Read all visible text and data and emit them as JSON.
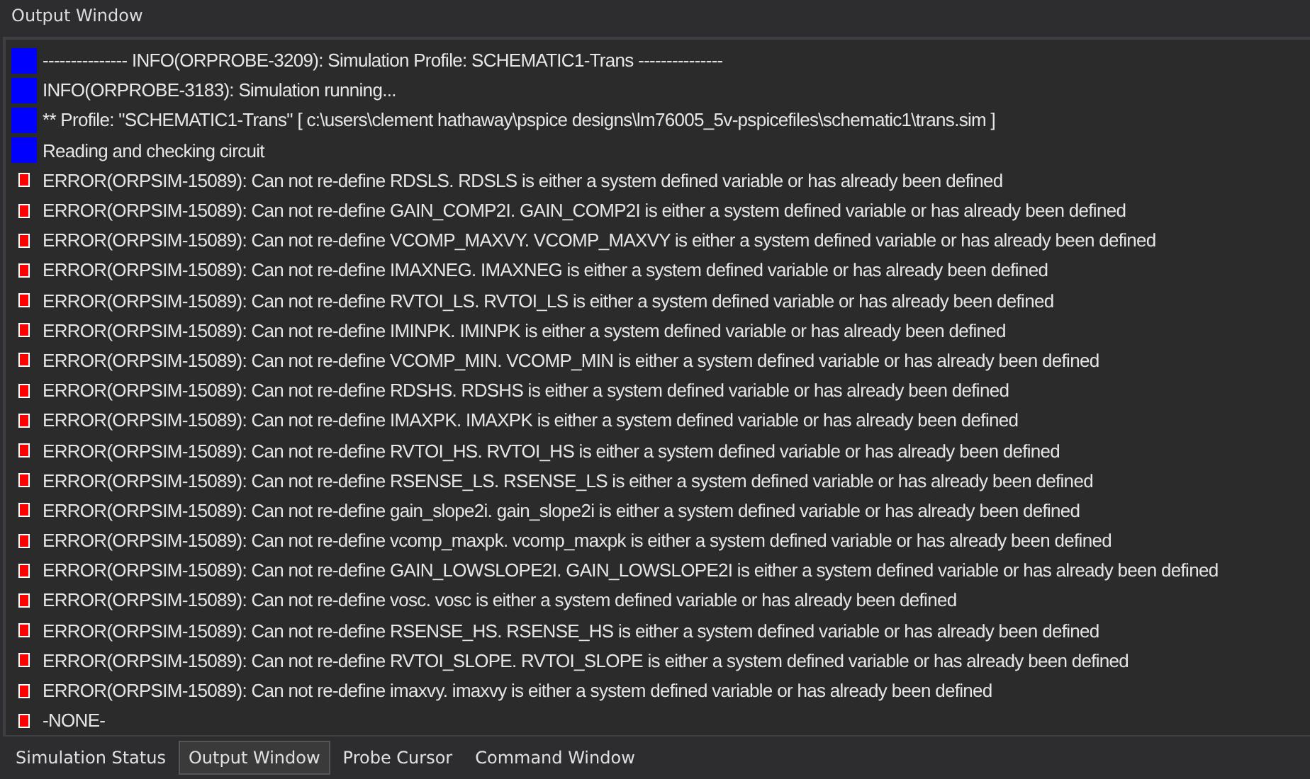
{
  "panel": {
    "title": "Output Window"
  },
  "lines": [
    {
      "kind": "info",
      "text": "--------------- INFO(ORPROBE-3209): Simulation Profile:  SCHEMATIC1-Trans ---------------"
    },
    {
      "kind": "info",
      "text": "INFO(ORPROBE-3183): Simulation running..."
    },
    {
      "kind": "info",
      "text": "** Profile: \"SCHEMATIC1-Trans\"  [ c:\\users\\clement hathaway\\pspice designs\\lm76005_5v-pspicefiles\\schematic1\\trans.sim ]"
    },
    {
      "kind": "info",
      "text": "Reading and checking circuit"
    },
    {
      "kind": "error",
      "text": "ERROR(ORPSIM-15089): Can not re-define RDSLS. RDSLS is either a system defined variable or has already been defined"
    },
    {
      "kind": "error",
      "text": "ERROR(ORPSIM-15089): Can not re-define GAIN_COMP2I. GAIN_COMP2I is either a system defined variable or has already been defined"
    },
    {
      "kind": "error",
      "text": "ERROR(ORPSIM-15089): Can not re-define VCOMP_MAXVY. VCOMP_MAXVY is either a system defined variable or has already been defined"
    },
    {
      "kind": "error",
      "text": "ERROR(ORPSIM-15089): Can not re-define IMAXNEG. IMAXNEG is either a system defined variable or has already been defined"
    },
    {
      "kind": "error",
      "text": "ERROR(ORPSIM-15089): Can not re-define RVTOI_LS. RVTOI_LS is either a system defined variable or has already been defined"
    },
    {
      "kind": "error",
      "text": "ERROR(ORPSIM-15089): Can not re-define IMINPK. IMINPK is either a system defined variable or has already been defined"
    },
    {
      "kind": "error",
      "text": "ERROR(ORPSIM-15089): Can not re-define VCOMP_MIN. VCOMP_MIN is either a system defined variable or has already been defined"
    },
    {
      "kind": "error",
      "text": "ERROR(ORPSIM-15089): Can not re-define RDSHS. RDSHS is either a system defined variable or has already been defined"
    },
    {
      "kind": "error",
      "text": "ERROR(ORPSIM-15089): Can not re-define IMAXPK. IMAXPK is either a system defined variable or has already been defined"
    },
    {
      "kind": "error",
      "text": "ERROR(ORPSIM-15089): Can not re-define RVTOI_HS. RVTOI_HS is either a system defined variable or has already been defined"
    },
    {
      "kind": "error",
      "text": "ERROR(ORPSIM-15089): Can not re-define RSENSE_LS. RSENSE_LS is either a system defined variable or has already been defined"
    },
    {
      "kind": "error",
      "text": "ERROR(ORPSIM-15089): Can not re-define gain_slope2i. gain_slope2i is either a system defined variable or has already been defined"
    },
    {
      "kind": "error",
      "text": "ERROR(ORPSIM-15089): Can not re-define vcomp_maxpk. vcomp_maxpk is either a system defined variable or has already been defined"
    },
    {
      "kind": "error",
      "text": "ERROR(ORPSIM-15089): Can not re-define GAIN_LOWSLOPE2I. GAIN_LOWSLOPE2I is either a system defined variable or has already been defined"
    },
    {
      "kind": "error",
      "text": "ERROR(ORPSIM-15089): Can not re-define vosc. vosc is either a system defined variable or has already been defined"
    },
    {
      "kind": "error",
      "text": "ERROR(ORPSIM-15089): Can not re-define RSENSE_HS. RSENSE_HS is either a system defined variable or has already been defined"
    },
    {
      "kind": "error",
      "text": "ERROR(ORPSIM-15089): Can not re-define RVTOI_SLOPE. RVTOI_SLOPE is either a system defined variable or has already been defined"
    },
    {
      "kind": "error",
      "text": "ERROR(ORPSIM-15089): Can not re-define imaxvy. imaxvy is either a system defined variable or has already been defined"
    },
    {
      "kind": "error",
      "text": "-NONE-"
    }
  ],
  "tabs": [
    {
      "label": "Simulation Status",
      "selected": false
    },
    {
      "label": "Output Window",
      "selected": true
    },
    {
      "label": "Probe Cursor",
      "selected": false
    },
    {
      "label": "Command Window",
      "selected": false
    }
  ]
}
